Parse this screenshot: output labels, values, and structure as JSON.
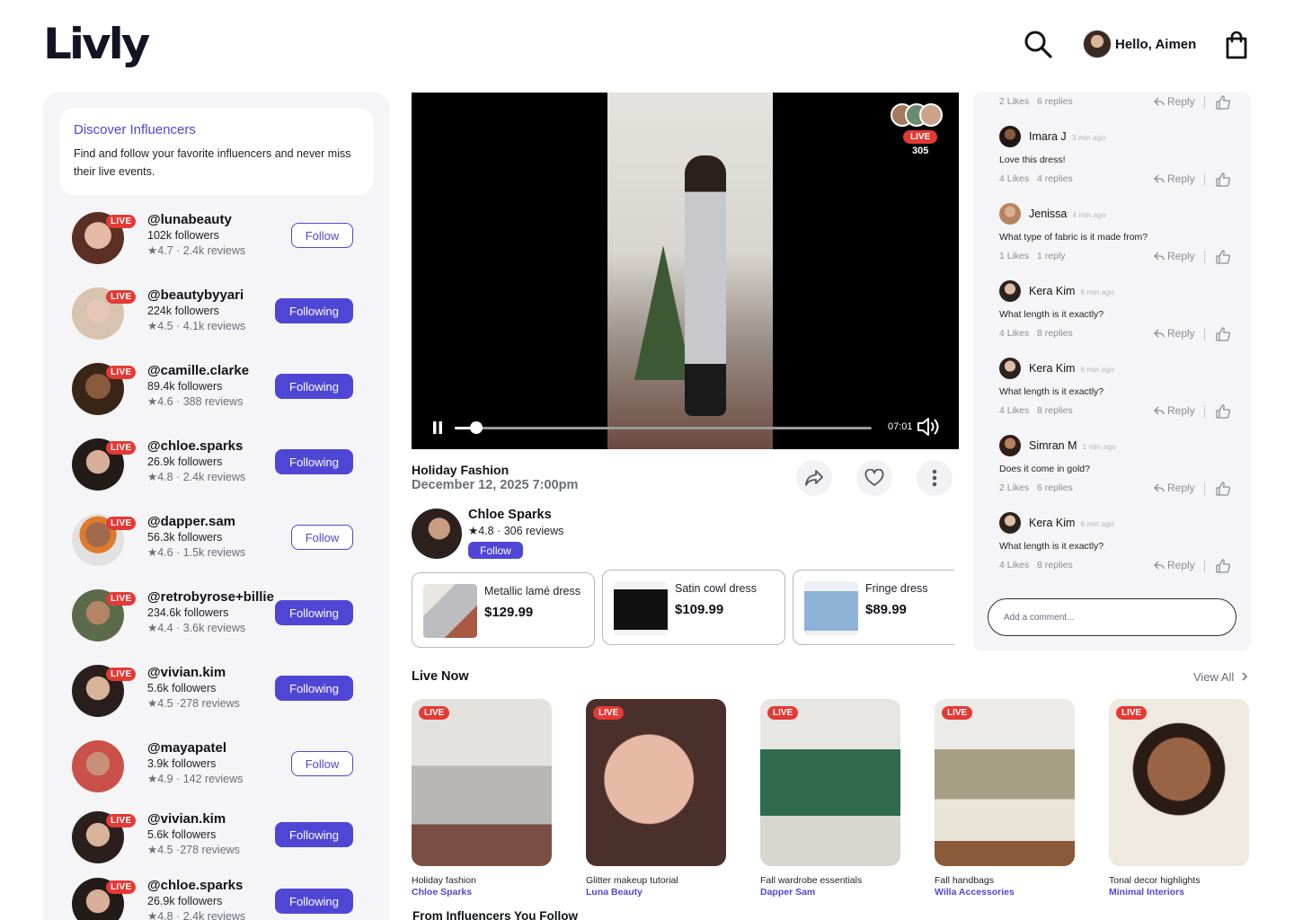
{
  "header": {
    "logo": "Livly",
    "greeting": "Hello, Aimen"
  },
  "sidebar": {
    "discover_title": "Discover Influencers",
    "discover_text": "Find and follow your favorite influencers and never miss their live events.",
    "live_label": "LIVE",
    "influencers": [
      {
        "handle": "@lunabeauty",
        "followers": "102k followers",
        "reviews": "★4.7 · 2.4k reviews",
        "button": "Follow",
        "live": true
      },
      {
        "handle": "@beautybyyari",
        "followers": "224k followers",
        "reviews": "★4.5 · 4.1k reviews",
        "button": "Following",
        "live": true
      },
      {
        "handle": "@camille.clarke",
        "followers": "89.4k followers",
        "reviews": "★4.6 · 388 reviews",
        "button": "Following",
        "live": true
      },
      {
        "handle": "@chloe.sparks",
        "followers": "26.9k followers",
        "reviews": "★4.8 · 2.4k reviews",
        "button": "Following",
        "live": true
      },
      {
        "handle": "@dapper.sam",
        "followers": "56.3k followers",
        "reviews": "★4.6 · 1.5k reviews",
        "button": "Follow",
        "live": true
      },
      {
        "handle": "@retrobyrose+billie",
        "followers": "234.6k followers",
        "reviews": "★4.4 · 3.6k reviews",
        "button": "Following",
        "live": true
      },
      {
        "handle": "@vivian.kim",
        "followers": "5.6k followers",
        "reviews": "★4.5 ·278 reviews",
        "button": "Following",
        "live": true
      },
      {
        "handle": "@mayapatel",
        "followers": "3.9k followers",
        "reviews": "★4.9 · 142 reviews",
        "button": "Follow",
        "live": false
      },
      {
        "handle": "@vivian.kim",
        "followers": "5.6k followers",
        "reviews": "★4.5 ·278 reviews",
        "button": "Following",
        "live": true
      },
      {
        "handle": "@chloe.sparks",
        "followers": "26.9k followers",
        "reviews": "★4.8 · 2.4k reviews",
        "button": "Following",
        "live": true
      }
    ]
  },
  "video": {
    "live_label": "LIVE",
    "viewer_count": "305",
    "time": "07:01",
    "progress": 0.04,
    "title": "Holiday Fashion",
    "date": "December 12, 2025 7:00pm",
    "host_name": "Chloe Sparks",
    "host_reviews": "★4.8 · 306 reviews",
    "host_follow": "Follow"
  },
  "products": [
    {
      "name": "Metallic lamé dress",
      "price": "$129.99"
    },
    {
      "name": "Satin cowl dress",
      "price": "$109.99"
    },
    {
      "name": "Fringe dress",
      "price": "$89.99"
    }
  ],
  "comments": {
    "reply_label": "Reply",
    "top_meta": {
      "likes": "2 Likes",
      "replies": "6 replies"
    },
    "items": [
      {
        "user": "Imara J",
        "time": "3 min ago",
        "text": "Love this dress!",
        "likes": "4 Likes",
        "replies": "4 replies"
      },
      {
        "user": "Jenissa",
        "time": "4 min ago",
        "text": "What type of fabric is it made from?",
        "likes": "1 Likes",
        "replies": "1 reply"
      },
      {
        "user": "Kera Kim",
        "time": "6 min ago",
        "text": "What length is it exactly?",
        "likes": "4 Likes",
        "replies": "8 replies"
      },
      {
        "user": "Kera Kim",
        "time": "6 min ago",
        "text": "What length is it exactly?",
        "likes": "4 Likes",
        "replies": "8 replies"
      },
      {
        "user": "Simran M",
        "time": "1 min ago",
        "text": "Does it come in gold?",
        "likes": "2 Likes",
        "replies": "6 replies"
      },
      {
        "user": "Kera Kim",
        "time": "6 min ago",
        "text": "What length is it exactly?",
        "likes": "4 Likes",
        "replies": "8 replies"
      }
    ],
    "add_placeholder": "Add a comment..."
  },
  "live_now": {
    "title": "Live Now",
    "view_all": "View All",
    "live_label": "LIVE",
    "cards": [
      {
        "title": "Holiday fashion",
        "host": "Chloe Sparks"
      },
      {
        "title": "Glitter makeup tutorial",
        "host": "Luna Beauty"
      },
      {
        "title": "Fall wardrobe essentials",
        "host": "Dapper Sam"
      },
      {
        "title": "Fall handbags",
        "host": "Willa Accessories"
      },
      {
        "title": "Tonal decor highlights",
        "host": "Minimal Interiors"
      }
    ]
  },
  "from_influencers_title": "From Influencers You Follow",
  "colors": {
    "accent": "#5046d6",
    "live": "#e53935",
    "panel": "#f5f5f7"
  }
}
